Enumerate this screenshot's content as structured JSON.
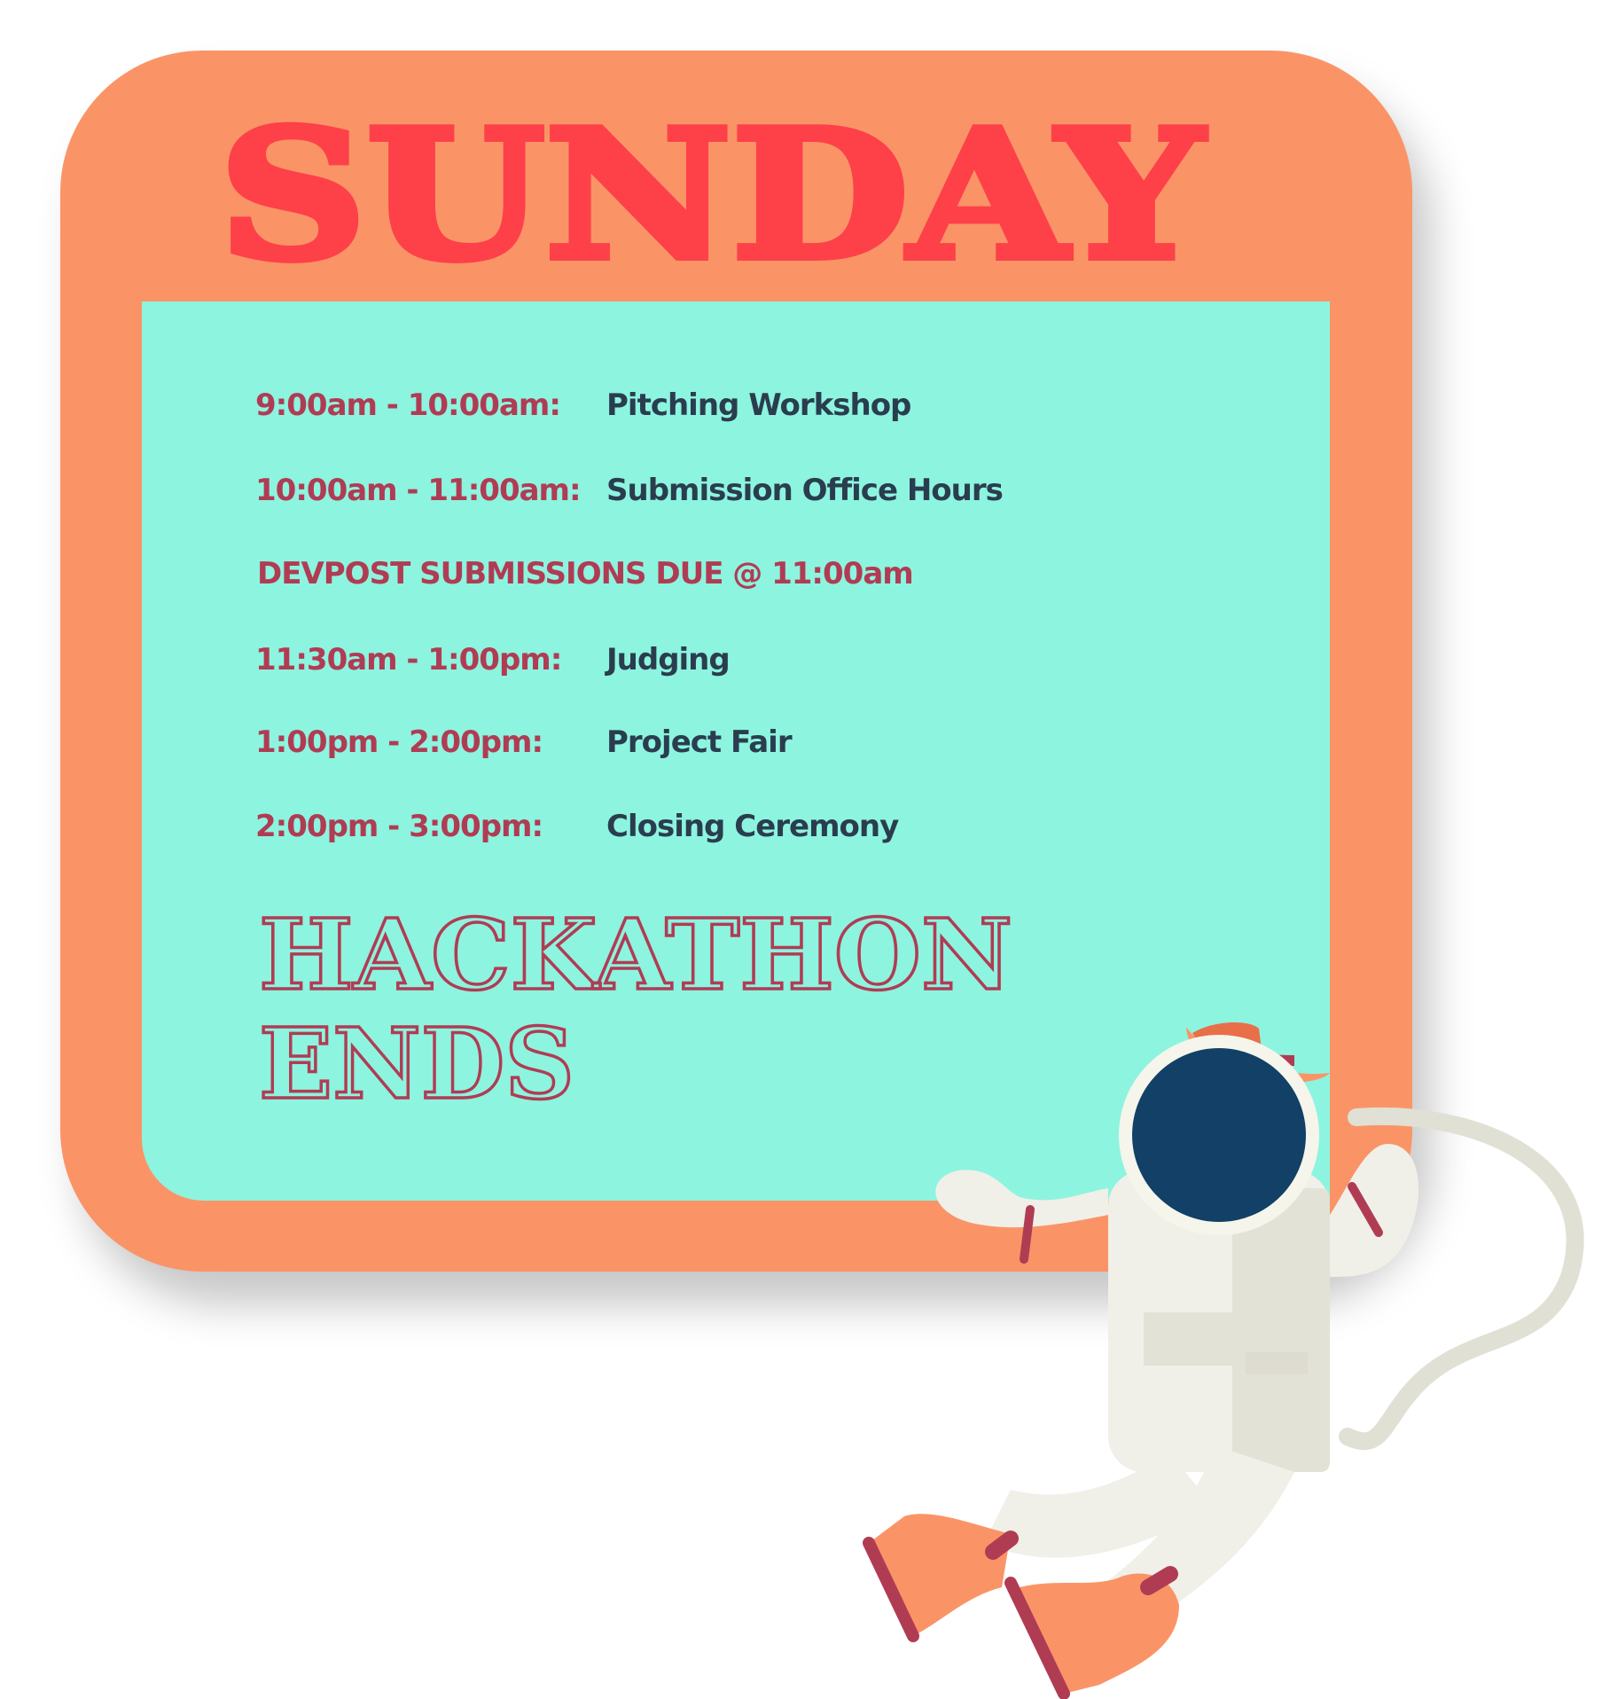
{
  "title": "SUNDAY",
  "schedule": [
    {
      "time": "9:00am - 10:00am:",
      "event": "Pitching Workshop"
    },
    {
      "time": "10:00am - 11:00am:",
      "event": "Submission Office Hours"
    },
    {
      "time": "11:30am - 1:00pm:",
      "event": "Judging"
    },
    {
      "time": "1:00pm - 2:00pm:",
      "event": "Project Fair"
    },
    {
      "time": "2:00pm - 3:00pm:",
      "event": "Closing Ceremony"
    }
  ],
  "deadline": "DEVPOST SUBMISSIONS DUE @ 11:00am",
  "closing": {
    "line1": "HACKATHON",
    "line2": "ENDS"
  },
  "colors": {
    "frame": "#fa9467",
    "panel": "#8df4df",
    "title": "#fe4049",
    "time": "#b03c54",
    "event": "#2a3d4e"
  },
  "illustration": "astronaut-with-cowboy-hat"
}
